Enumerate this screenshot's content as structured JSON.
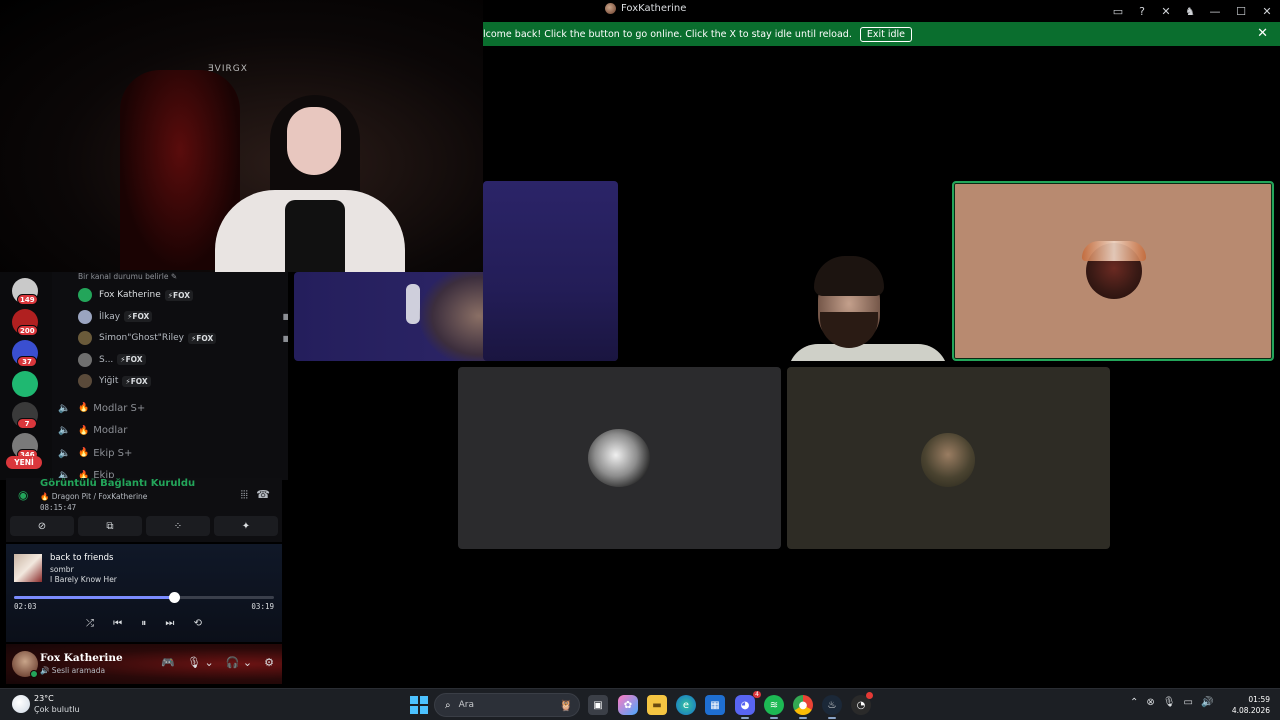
{
  "window": {
    "title": "FoxKatherine"
  },
  "notice": {
    "message": "lcome back! Click the button to go online. Click the X to stay idle until reload.",
    "button_label": "Exit idle"
  },
  "webcam": {
    "logo_text": "ƎVIRGX"
  },
  "servers": [
    {
      "badge": "149",
      "color": "#c9c9c9"
    },
    {
      "badge": "200",
      "color": "#b02020"
    },
    {
      "badge": "37",
      "color": "#3a4fd0"
    },
    {
      "badge": "",
      "color": "#1fb871"
    },
    {
      "badge": "7",
      "color": "#3a3a3a"
    },
    {
      "badge": "346",
      "color": "#7a7a7a"
    }
  ],
  "new_badge": "YENİ",
  "channel_panel": {
    "status_prompt": "Bir kanal durumu belirle",
    "members": [
      {
        "name": "Fox Katherine",
        "tag": "⚡FOX",
        "camera": false,
        "color": "#23a55a"
      },
      {
        "name": "İlkay",
        "tag": "⚡FOX",
        "camera": true,
        "color": "#9aa4c0"
      },
      {
        "name": "Simon\"Ghost\"Riley",
        "tag": "⚡FOX",
        "camera": true,
        "color": "#6a5a3a"
      },
      {
        "name": "S...",
        "tag": "⚡FOX",
        "camera": false,
        "color": "#6f6f6f"
      },
      {
        "name": "Yiğit",
        "tag": "⚡FOX",
        "camera": false,
        "color": "#5a4a3a"
      }
    ],
    "voice_channels": [
      {
        "name": "Modlar S+"
      },
      {
        "name": "Modlar"
      },
      {
        "name": "Ekip S+"
      },
      {
        "name": "Ekip"
      }
    ]
  },
  "voice": {
    "title": "Görüntülü Bağlantı Kuruldu",
    "channel": "Dragon Pit / FoxKatherine",
    "elapsed": "08:15:47"
  },
  "spotify": {
    "song": "back to friends",
    "artist": "sombr",
    "album": "I Barely Know Her",
    "position": "02:03",
    "duration": "03:19",
    "progress": 0.617
  },
  "user": {
    "name": "Fox Katherine",
    "status": "Sesli aramada"
  },
  "taskbar": {
    "temperature": "23°C",
    "condition": "Çok bulutlu",
    "search_placeholder": "Ara",
    "time": "01:59",
    "date": "4.08.2026",
    "discord_badge": "4"
  }
}
